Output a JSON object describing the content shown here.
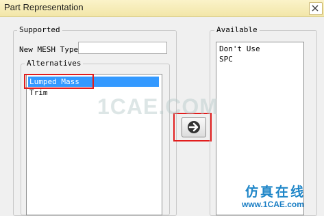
{
  "window": {
    "title": "Part Representation"
  },
  "supported": {
    "group_label": "Supported",
    "new_mesh_type_label": "New MESH Type",
    "new_mesh_type_value": "",
    "alternatives": {
      "group_label": "Alternatives",
      "items": [
        "Lumped Mass",
        "Trim"
      ],
      "selected": "Lumped Mass"
    }
  },
  "available": {
    "group_label": "Available",
    "items": [
      "Don't Use",
      "SPC"
    ]
  },
  "move_button": {
    "icon": "arrow-right-icon"
  },
  "watermark": {
    "text": "1CAE.COM"
  },
  "branding": {
    "cn_text": "仿真在线",
    "url_text": "www.1CAE.com"
  },
  "colors": {
    "selection": "#3399ff",
    "highlight": "#e21d1d",
    "brand": "#1f86c8"
  }
}
